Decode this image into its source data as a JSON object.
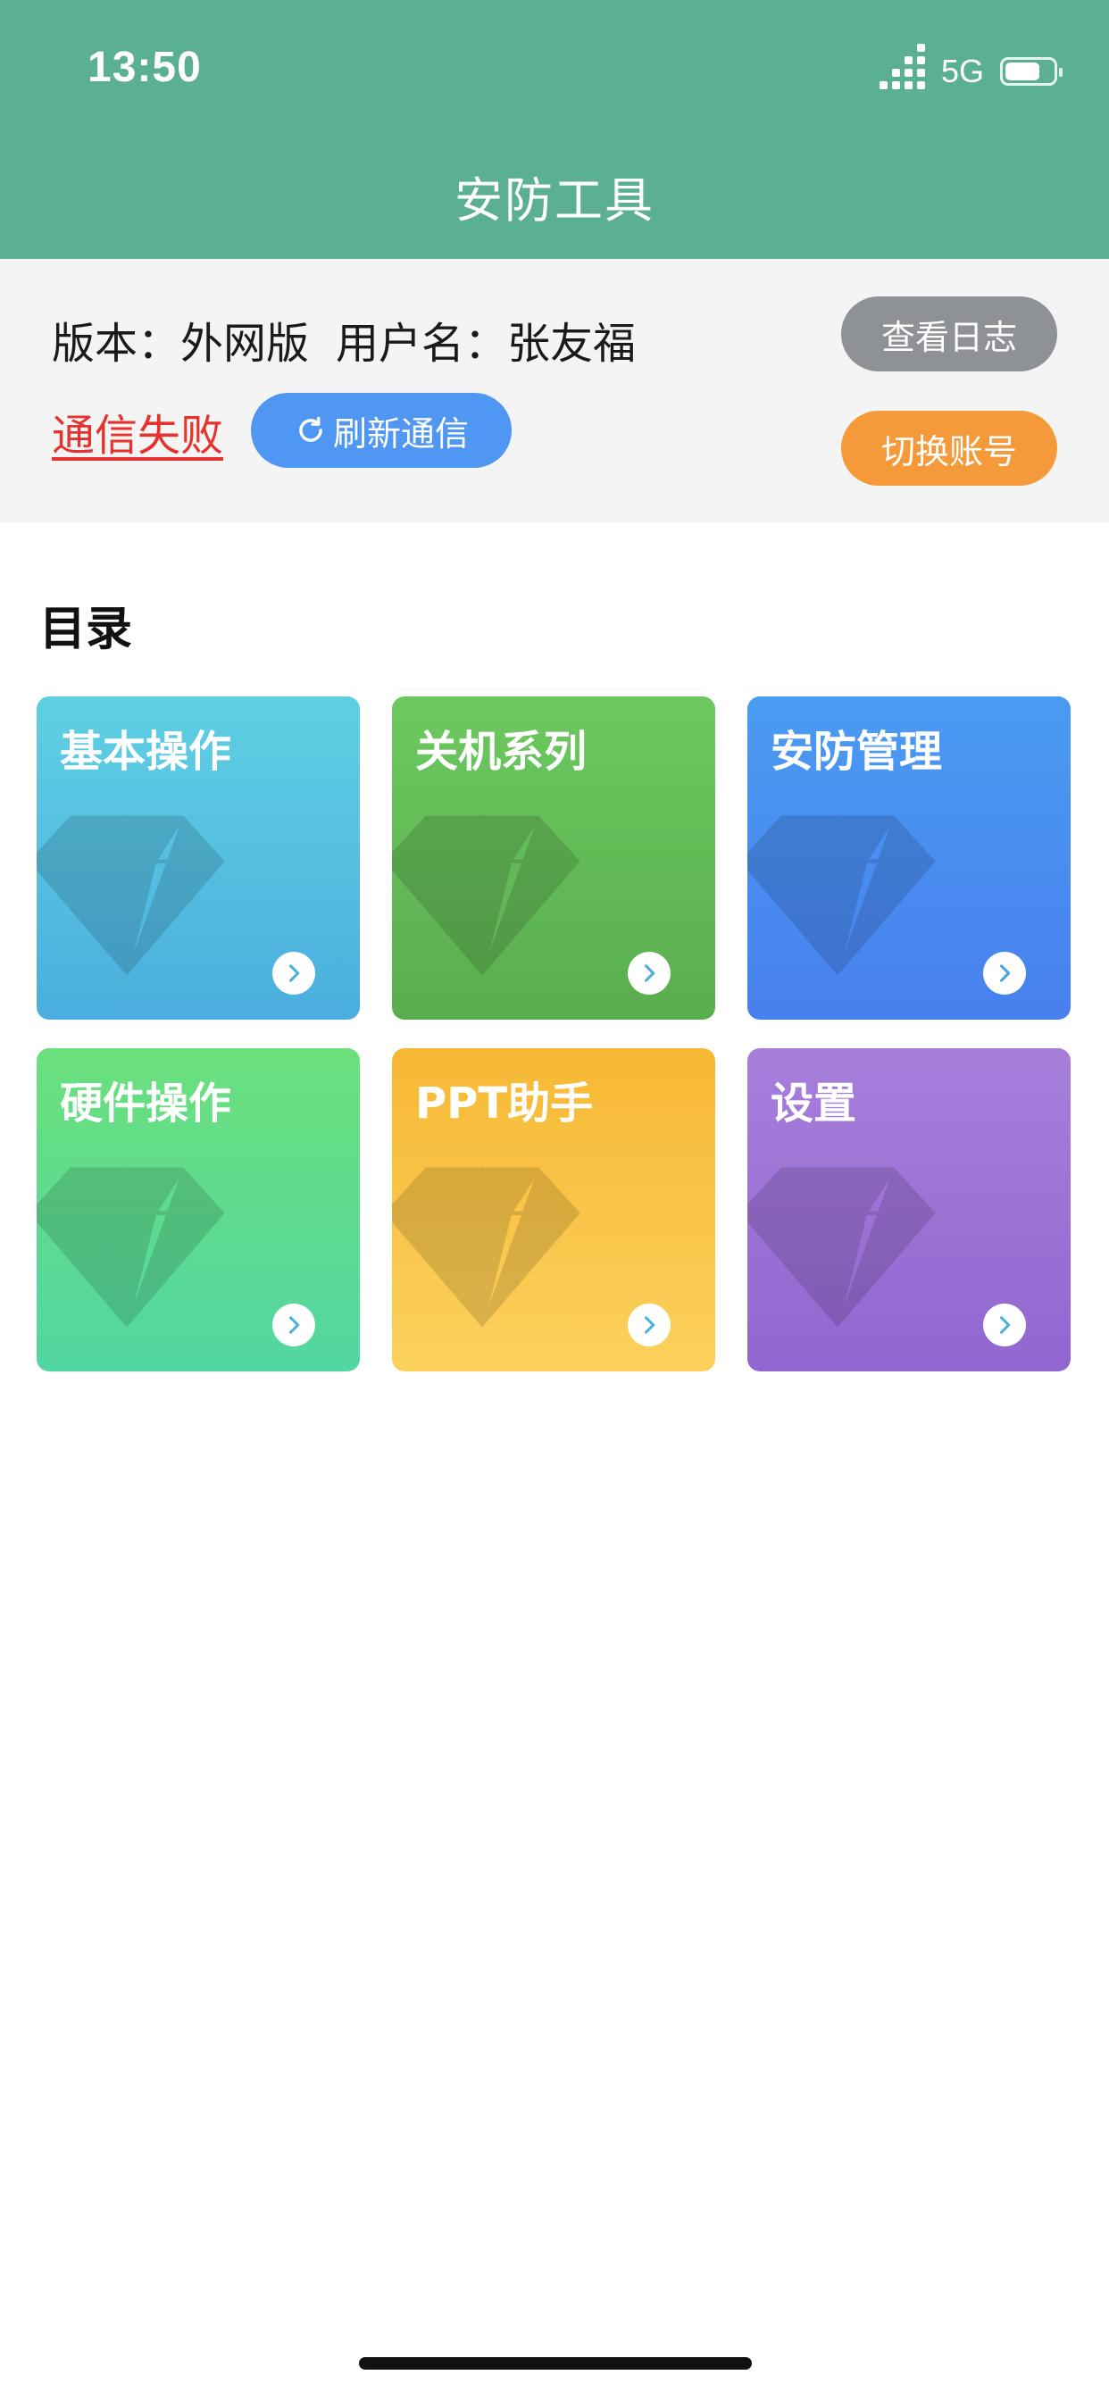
{
  "status_bar": {
    "time": "13:50",
    "network": "5G"
  },
  "header": {
    "title": "安防工具"
  },
  "info": {
    "version_text": "版本：外网版",
    "username_text": "用户名：张友福",
    "comm_status": "通信失败",
    "refresh_label": "刷新通信",
    "view_log_label": "查看日志",
    "switch_account_label": "切换账号"
  },
  "directory": {
    "title": "目录",
    "cards": [
      {
        "label": "基本操作",
        "color_top": "#5fd0e3",
        "color_bottom": "#4baede",
        "arrow_color": "#49b0d8"
      },
      {
        "label": "关机系列",
        "color_top": "#6cc95f",
        "color_bottom": "#5aad4e",
        "arrow_color": "#4faed8"
      },
      {
        "label": "安防管理",
        "color_top": "#4a9bf2",
        "color_bottom": "#4880ee",
        "arrow_color": "#4aa6e2"
      },
      {
        "label": "硬件操作",
        "color_top": "#6be07c",
        "color_bottom": "#52d6a2",
        "arrow_color": "#4ab3d6"
      },
      {
        "label": "PPT助手",
        "color_top": "#f7b835",
        "color_bottom": "#fbd15c",
        "arrow_color": "#4ab3d6"
      },
      {
        "label": "设置",
        "color_top": "#a77fdb",
        "color_bottom": "#9266d0",
        "arrow_color": "#4ab3d6"
      }
    ]
  },
  "colors": {
    "header": "#5bb092",
    "error": "#e5322d",
    "refresh": "#4f97f3",
    "log": "#8e9196",
    "switch": "#f59a3a"
  }
}
